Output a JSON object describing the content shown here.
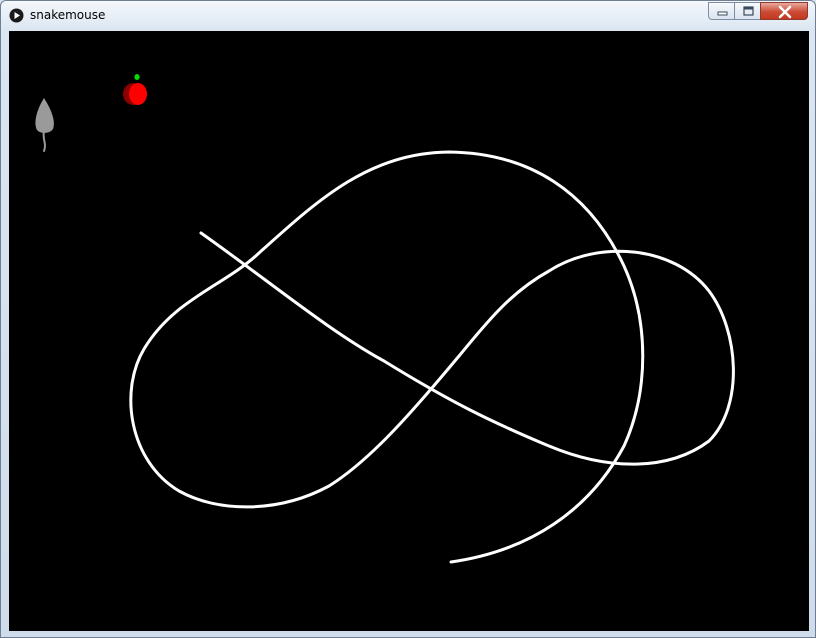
{
  "window": {
    "title": "snakemouse"
  },
  "icons": {
    "app": "play-circle-icon",
    "minimize": "minimize-icon",
    "maximize": "maximize-icon",
    "close": "close-icon"
  },
  "game": {
    "background": "#000000",
    "snake_color": "#ffffff",
    "mouse_color": "#9a9a9a",
    "apple_color": "#ff0000",
    "apple_stem_color": "#00e000"
  }
}
